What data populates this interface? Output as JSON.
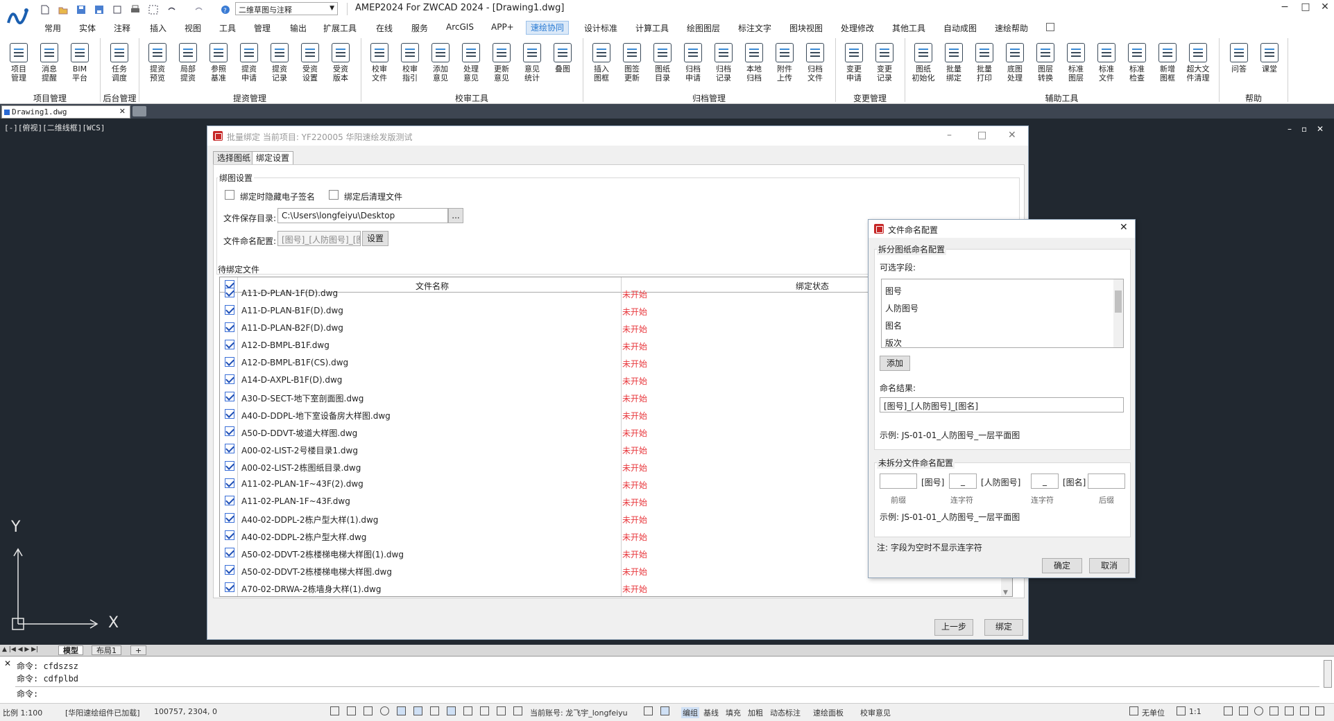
{
  "app": {
    "title": "AMEP2024 For ZWCAD 2024 - [Drawing1.dwg]",
    "workspace": "二维草图与注释",
    "window_controls": [
      "−",
      "□",
      "✕"
    ]
  },
  "menu_tabs": [
    "常用",
    "实体",
    "注释",
    "插入",
    "视图",
    "工具",
    "管理",
    "输出",
    "扩展工具",
    "在线",
    "服务",
    "ArcGIS",
    "APP+",
    "速绘协同",
    "设计标准",
    "计算工具",
    "绘图图层",
    "标注文字",
    "图块视图",
    "处理修改",
    "其他工具",
    "自动成图",
    "速绘帮助"
  ],
  "active_tab": "速绘协同",
  "ribbon": {
    "buttons": [
      {
        "label": "项目\n管理"
      },
      {
        "label": "消息\n提醒"
      },
      {
        "label": "BIM\n平台"
      },
      {
        "label": "任务\n调度"
      },
      {
        "label": "提资\n预览"
      },
      {
        "label": "局部\n提资"
      },
      {
        "label": "参照\n基准"
      },
      {
        "label": "提资\n申请"
      },
      {
        "label": "提资\n记录"
      },
      {
        "label": "受资\n设置"
      },
      {
        "label": "受资\n版本"
      },
      {
        "label": "校审\n文件"
      },
      {
        "label": "校审\n指引"
      },
      {
        "label": "添加\n意见"
      },
      {
        "label": "处理\n意见"
      },
      {
        "label": "更新\n意见"
      },
      {
        "label": "意见\n统计"
      },
      {
        "label": "叠图"
      },
      {
        "label": "插入\n图框"
      },
      {
        "label": "图签\n更新"
      },
      {
        "label": "图纸\n目录"
      },
      {
        "label": "归档\n申请"
      },
      {
        "label": "归档\n记录"
      },
      {
        "label": "本地\n归档"
      },
      {
        "label": "附件\n上传"
      },
      {
        "label": "归档\n文件"
      },
      {
        "label": "变更\n申请"
      },
      {
        "label": "变更\n记录"
      },
      {
        "label": "图纸\n初始化"
      },
      {
        "label": "批量\n绑定"
      },
      {
        "label": "批量\n打印"
      },
      {
        "label": "底图\n处理"
      },
      {
        "label": "图层\n转换"
      },
      {
        "label": "标准\n图层"
      },
      {
        "label": "标准\n文件"
      },
      {
        "label": "标准\n检查"
      },
      {
        "label": "新增\n图框"
      },
      {
        "label": "超大文\n件清理"
      },
      {
        "label": "问答"
      },
      {
        "label": "课堂"
      }
    ],
    "groups": [
      "项目管理",
      "后台管理",
      "提资管理",
      "校审工具",
      "归档管理",
      "变更管理",
      "辅助工具",
      "帮助"
    ]
  },
  "file_tab": {
    "name": "Drawing1.dwg",
    "close": "✕"
  },
  "viewport_label": "[-][俯视][二维线框][WCS]",
  "ucs": {
    "y": "Y",
    "x": "X"
  },
  "layout_tabs": [
    "模型",
    "布局1",
    "+"
  ],
  "command": {
    "history": [
      "命令: cfdszsz",
      "命令: cdfplbd"
    ],
    "prompt": "命令:"
  },
  "status": {
    "scale": "比例 1:100",
    "plugin": "[华阳速绘组件已加载]",
    "coords": "100757, 2304, 0",
    "account": "当前账号: 龙飞宇_longfeiyu",
    "items": [
      "编组",
      "基线",
      "填充",
      "加粗",
      "动态标注",
      "速绘面板",
      "校审意见"
    ],
    "right": [
      "无单位",
      "1:1"
    ]
  },
  "batch_dialog": {
    "title": "批量绑定 当前项目: YF220005 华阳速绘发版测试",
    "tabs": [
      "选择图纸",
      "绑定设置"
    ],
    "section_bind": "绑图设置",
    "opt_hide_sign": "绑定时隐藏电子签名",
    "opt_clean": "绑定后清理文件",
    "save_dir_label": "文件保存目录:",
    "save_dir_value": "C:\\Users\\longfeiyu\\Desktop",
    "browse": "...",
    "naming_label": "文件命名配置:",
    "naming_value": "[图号]_[人防图号]_[图名]",
    "naming_btn": "设置",
    "section_files": "待绑定文件",
    "col_name": "文件名称",
    "col_status": "绑定状态",
    "rows": [
      {
        "name": "A11-D-PLAN-1F(D).dwg",
        "status": "未开始"
      },
      {
        "name": "A11-D-PLAN-B1F(D).dwg",
        "status": "未开始"
      },
      {
        "name": "A11-D-PLAN-B2F(D).dwg",
        "status": "未开始"
      },
      {
        "name": "A12-D-BMPL-B1F.dwg",
        "status": "未开始"
      },
      {
        "name": "A12-D-BMPL-B1F(CS).dwg",
        "status": "未开始"
      },
      {
        "name": "A14-D-AXPL-B1F(D).dwg",
        "status": "未开始"
      },
      {
        "name": "A30-D-SECT-地下室剖面图.dwg",
        "status": "未开始"
      },
      {
        "name": "A40-D-DDPL-地下室设备房大样图.dwg",
        "status": "未开始"
      },
      {
        "name": "A50-D-DDVT-坡道大样图.dwg",
        "status": "未开始"
      },
      {
        "name": "A00-02-LIST-2号楼目录1.dwg",
        "status": "未开始"
      },
      {
        "name": "A00-02-LIST-2栋图纸目录.dwg",
        "status": "未开始"
      },
      {
        "name": "A11-02-PLAN-1F~43F(2).dwg",
        "status": "未开始"
      },
      {
        "name": "A11-02-PLAN-1F~43F.dwg",
        "status": "未开始"
      },
      {
        "name": "A40-02-DDPL-2栋户型大样(1).dwg",
        "status": "未开始"
      },
      {
        "name": "A40-02-DDPL-2栋户型大样.dwg",
        "status": "未开始"
      },
      {
        "name": "A50-02-DDVT-2栋楼梯电梯大样图(1).dwg",
        "status": "未开始"
      },
      {
        "name": "A50-02-DDVT-2栋楼梯电梯大样图.dwg",
        "status": "未开始"
      },
      {
        "name": "A70-02-DRWA-2栋墙身大样(1).dwg",
        "status": "未开始"
      }
    ],
    "btn_prev": "上一步",
    "btn_bind": "绑定"
  },
  "naming_dialog": {
    "title": "文件命名配置",
    "section_split": "拆分图纸命名配置",
    "fields_label": "可选字段:",
    "fields": [
      "图号",
      "人防图号",
      "图名",
      "版次"
    ],
    "add": "添加",
    "result_label": "命名结果:",
    "result_value": "[图号]_[人防图号]_[图名]",
    "example1": "示例: JS-01-01_人防图号_一层平面图",
    "section_unsplit": "未拆分文件命名配置",
    "tok_drawno": "[图号]",
    "sep1": "_",
    "tok_civil": "[人防图号]",
    "sep2": "_",
    "tok_name": "[图名]",
    "hint_prefix": "前缀",
    "hint_sep1": "连字符",
    "hint_sep2": "连字符",
    "hint_suffix": "后缀",
    "example2": "示例: JS-01-01_人防图号_一层平面图",
    "note": "注: 字段为空时不显示连字符",
    "ok": "确定",
    "cancel": "取消"
  }
}
